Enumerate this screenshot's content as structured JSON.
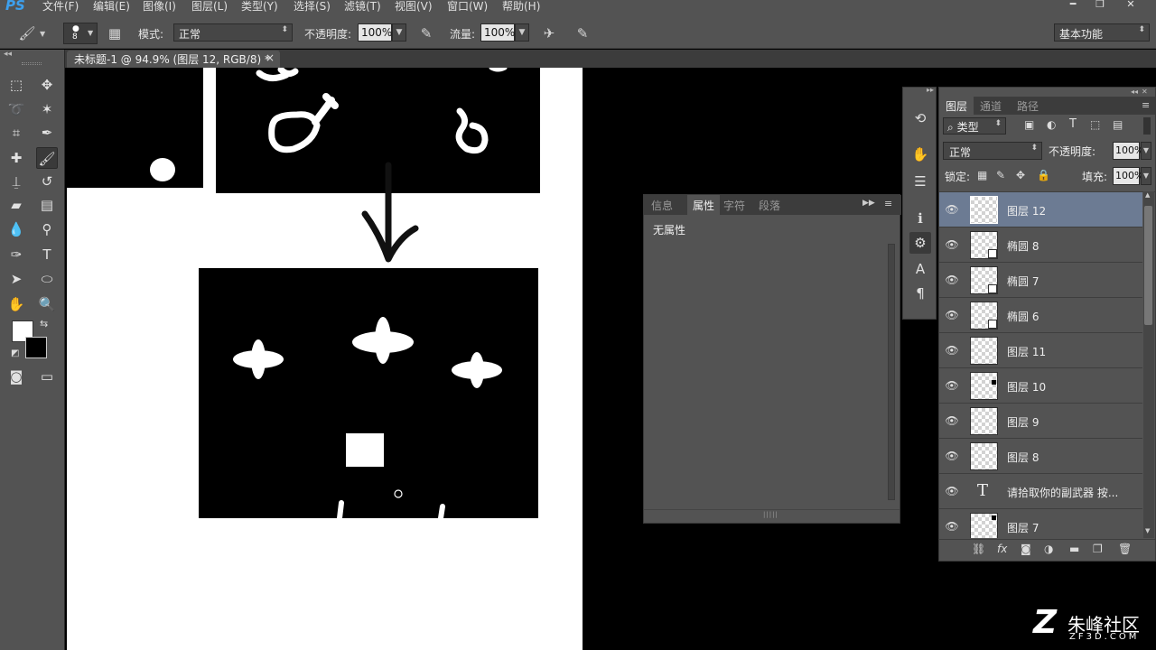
{
  "app": {
    "logo": "PS"
  },
  "menu": [
    "文件(F)",
    "编辑(E)",
    "图像(I)",
    "图层(L)",
    "类型(Y)",
    "选择(S)",
    "滤镜(T)",
    "视图(V)",
    "窗口(W)",
    "帮助(H)"
  ],
  "options": {
    "brush_size": "8",
    "mode_label": "模式:",
    "mode_value": "正常",
    "opacity_label": "不透明度:",
    "opacity_value": "100%",
    "flow_label": "流量:",
    "flow_value": "100%",
    "workspace": "基本功能"
  },
  "document": {
    "tab_title": "未标题-1 @ 94.9% (图层 12, RGB/8) *",
    "close": "×"
  },
  "properties": {
    "tabs": [
      "信息",
      "属性",
      "字符",
      "段落"
    ],
    "active_tab": "属性",
    "content": "无属性"
  },
  "layers_panel": {
    "tabs": [
      "图层",
      "通道",
      "路径"
    ],
    "filter_label": "类型",
    "blend_mode": "正常",
    "opacity_label": "不透明度:",
    "opacity_value": "100%",
    "lock_label": "锁定:",
    "fill_label": "填充:",
    "fill_value": "100%",
    "layers": [
      {
        "name": "图层 12",
        "selected": true,
        "kind": "pixel"
      },
      {
        "name": "椭圆 8",
        "selected": false,
        "kind": "shape"
      },
      {
        "name": "椭圆 7",
        "selected": false,
        "kind": "shape"
      },
      {
        "name": "椭圆 6",
        "selected": false,
        "kind": "shape"
      },
      {
        "name": "图层 11",
        "selected": false,
        "kind": "pixel"
      },
      {
        "name": "图层 10",
        "selected": false,
        "kind": "pixel-dot"
      },
      {
        "name": "图层 9",
        "selected": false,
        "kind": "pixel"
      },
      {
        "name": "图层 8",
        "selected": false,
        "kind": "pixel"
      },
      {
        "name": "请拾取你的副武器 按...",
        "selected": false,
        "kind": "text"
      },
      {
        "name": "图层 7",
        "selected": false,
        "kind": "pixel-dot2"
      }
    ]
  },
  "watermark": {
    "brand": "朱峰社区",
    "site": "ZF3D.COM"
  },
  "colors": {
    "panel": "#535353",
    "dark": "#3c3c3c",
    "selected_layer": "#6c7b93",
    "accent": "#3da0ee"
  }
}
